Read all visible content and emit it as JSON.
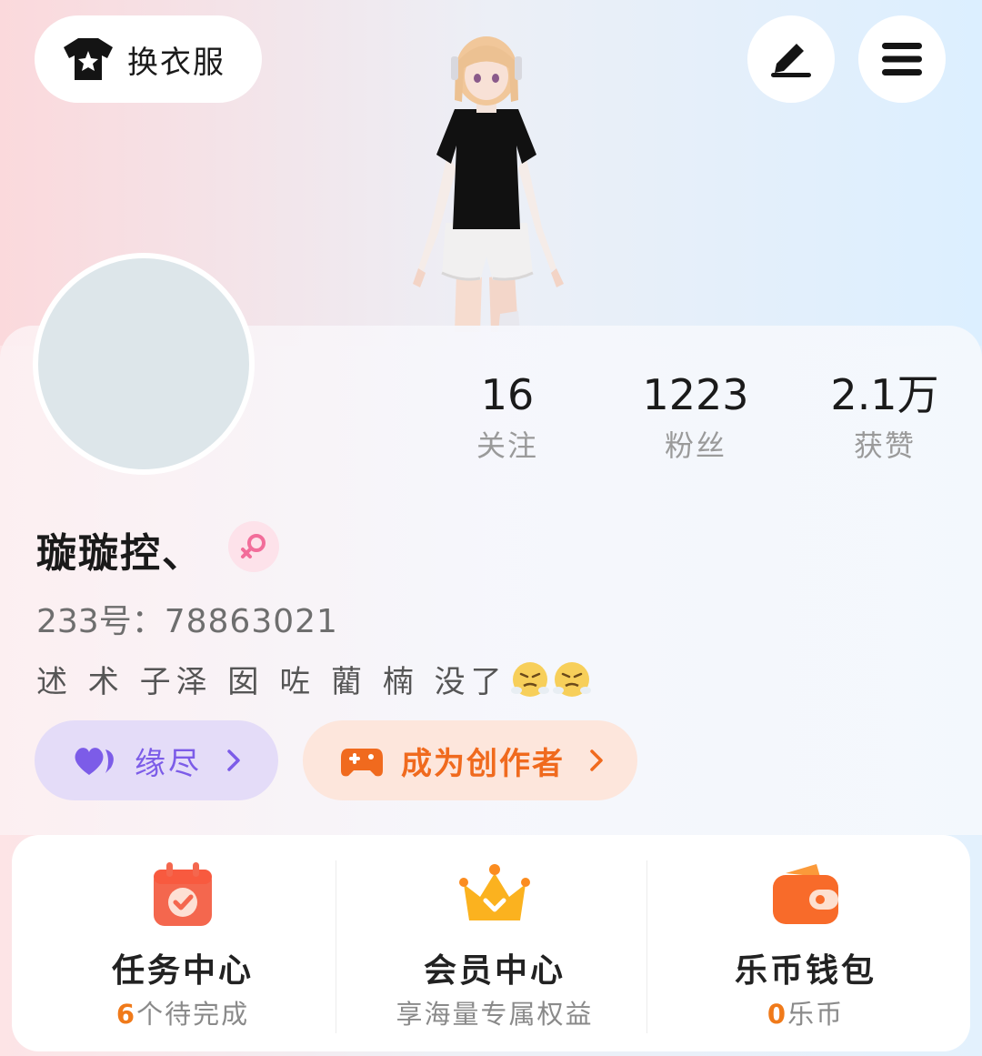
{
  "header": {
    "outfit_label": "换衣服",
    "edit_icon": "pen-icon",
    "menu_icon": "hamburger-icon"
  },
  "stats": [
    {
      "value": "16",
      "label": "关注"
    },
    {
      "value": "1223",
      "label": "粉丝"
    },
    {
      "value": "2.1万",
      "label": "获赞"
    }
  ],
  "profile": {
    "username": "璇璇控、",
    "gender": "female",
    "id_label": "233号：",
    "id_value": "78863021",
    "bio": "述 术 子泽 囡 咗 藺 楠  没了"
  },
  "chips": {
    "relation_label": "缘尽",
    "creator_label": "成为创作者"
  },
  "panel": [
    {
      "title": "任务中心",
      "sub_highlight": "6",
      "sub_text": "个待完成",
      "icon": "calendar-check-icon"
    },
    {
      "title": "会员中心",
      "sub_highlight": "",
      "sub_text": "享海量专属权益",
      "icon": "crown-icon"
    },
    {
      "title": "乐币钱包",
      "sub_highlight": "0",
      "sub_text": "乐币",
      "icon": "wallet-icon"
    }
  ],
  "colors": {
    "relation_accent": "#7c5ce8",
    "creator_accent": "#f06a1e",
    "highlight_orange": "#f07a1a",
    "gender_pink": "#f26d9a"
  }
}
